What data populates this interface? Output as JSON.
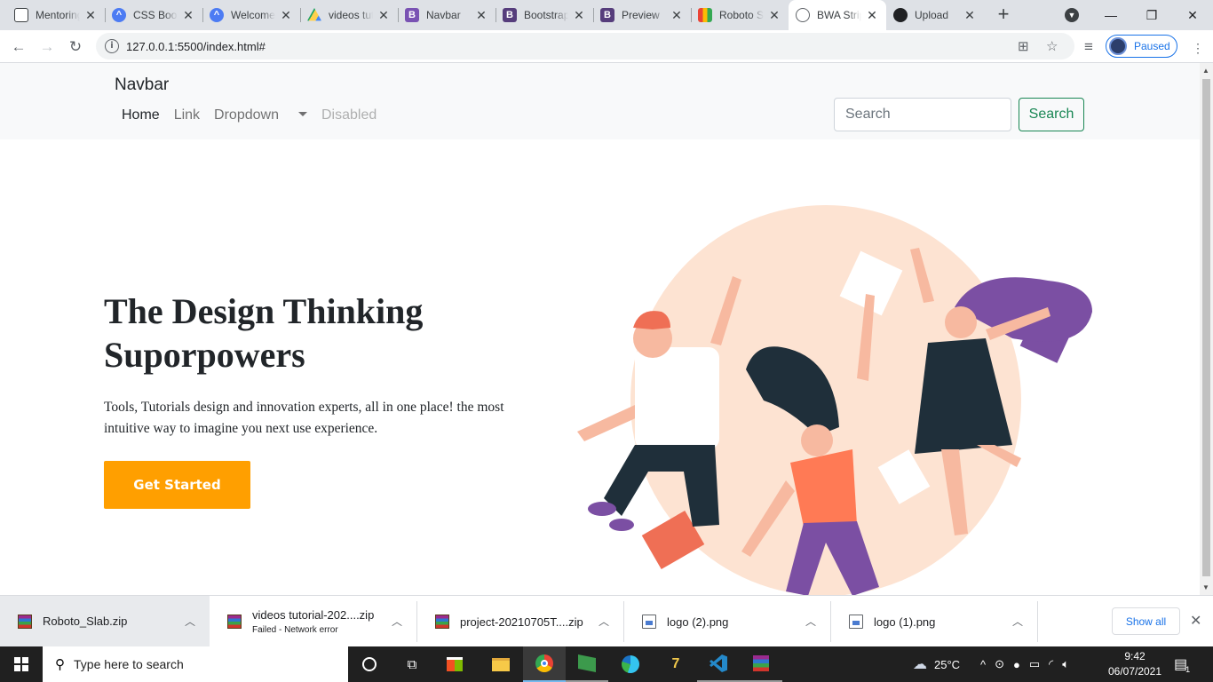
{
  "browser": {
    "tabs": [
      {
        "title": "Mentoring",
        "favicon": "mentoring-icon",
        "favicon_color": "#3c4043"
      },
      {
        "title": "CSS Book",
        "favicon": "css-book-icon",
        "favicon_color": "#4c7bf3"
      },
      {
        "title": "Welcome",
        "favicon": "welcome-icon",
        "favicon_color": "#4c7bf3"
      },
      {
        "title": "videos tutorial",
        "favicon": "google-drive-icon",
        "favicon_color": "#1fa463"
      },
      {
        "title": "Navbar",
        "favicon": "bootstrap-icon",
        "favicon_color": "#7952b3"
      },
      {
        "title": "Bootstrap",
        "favicon": "bootstrap-icon",
        "favicon_color": "#7952b3"
      },
      {
        "title": "Preview",
        "favicon": "bootstrap-icon",
        "favicon_color": "#7952b3"
      },
      {
        "title": "Roboto Slab",
        "favicon": "google-fonts-icon",
        "favicon_color": "#ea4335"
      },
      {
        "title": "BWA Strip",
        "favicon": "globe-icon",
        "favicon_color": "#5f6368"
      },
      {
        "title": "Upload",
        "favicon": "github-icon",
        "favicon_color": "#202124"
      }
    ],
    "url": "127.0.0.1:5500/index.html#",
    "profile_status": "Paused"
  },
  "page": {
    "navbar": {
      "brand": "Navbar",
      "links": [
        {
          "label": "Home",
          "state": "active"
        },
        {
          "label": "Link",
          "state": "normal"
        },
        {
          "label": "Dropdown",
          "state": "dropdown"
        },
        {
          "label": "Disabled",
          "state": "disabled"
        }
      ],
      "search_placeholder": "Search",
      "search_button": "Search"
    },
    "hero": {
      "title_line1": "The Design Thinking",
      "title_line2": "Suporpowers",
      "description": "Tools, Tutorials design and innovation experts, all in one place! the most intuitive way to imagine you next use experience.",
      "cta_label": "Get Started",
      "cta_color": "#ff9f00"
    }
  },
  "downloads": {
    "items": [
      {
        "name": "Roboto_Slab.zip",
        "status": "",
        "type": "rar"
      },
      {
        "name": "videos tutorial-202....zip",
        "status": "Failed - Network error",
        "type": "rar"
      },
      {
        "name": "project-20210705T....zip",
        "status": "",
        "type": "rar"
      },
      {
        "name": "logo (2).png",
        "status": "",
        "type": "png"
      },
      {
        "name": "logo (1).png",
        "status": "",
        "type": "png"
      }
    ],
    "show_all": "Show all"
  },
  "taskbar": {
    "search_placeholder": "Type here to search",
    "weather": "25°C",
    "time": "9:42",
    "date": "06/07/2021",
    "notification_count": "1"
  }
}
